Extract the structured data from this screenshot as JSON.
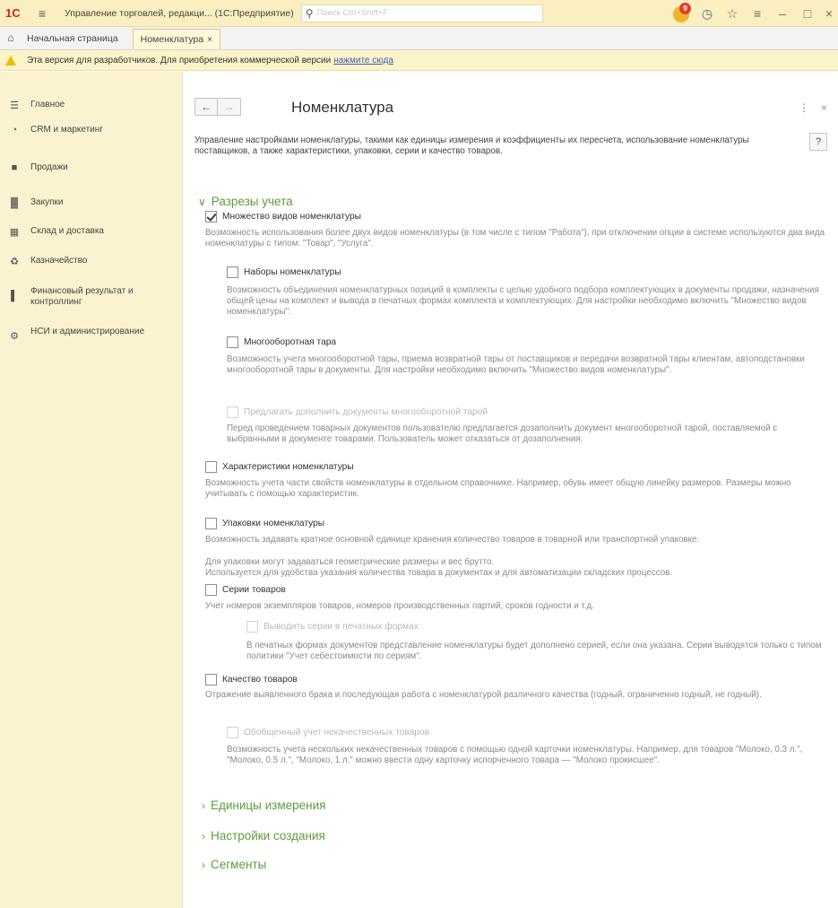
{
  "titlebar": {
    "logo": "1С",
    "title": "Управление торговлей, редакци... (1С:Предприятие)",
    "search_placeholder": "Поиск Ctrl+Shift+F",
    "notifications_count": "9"
  },
  "tabs": {
    "home_label": "Начальная страница",
    "active_label": "Номенклатура"
  },
  "warning": {
    "text": "Эта версия для разработчиков. Для приобретения коммерческой версии",
    "link": "нажмите сюда"
  },
  "sidebar": {
    "items": [
      {
        "label": "Главное",
        "icon": "menu-icon"
      },
      {
        "label": "CRM и маркетинг",
        "icon": "crm-icon"
      },
      {
        "label": "Продажи",
        "icon": "sales-icon"
      },
      {
        "label": "Закупки",
        "icon": "cart-icon"
      },
      {
        "label": "Склад и доставка",
        "icon": "warehouse-icon"
      },
      {
        "label": "Казначейство",
        "icon": "treasury-icon"
      },
      {
        "label": "Финансовый результат и контроллинг",
        "icon": "chart-icon"
      },
      {
        "label": "НСИ и администрирование",
        "icon": "gear-icon"
      }
    ]
  },
  "main": {
    "title": "Номенклатура",
    "description": "Управление настройками номенклатуры, такими как единицы измерения и коэффициенты их пересчета, использование номенклатуры поставщиков, а также характеристики, упаковки, серии и качество товаров.",
    "help": "?",
    "section_open": "Разрезы учета",
    "options": [
      {
        "label": "Множество видов номенклатуры",
        "checked": true,
        "disabled": false,
        "hint": "Возможность использования более двух видов номенклатуры (в том числе с типом \"Работа\"), при отключении опции в системе используются два вида номенклатуры с типом: \"Товар\", \"Услуга\"."
      },
      {
        "label": "Наборы номенклатуры",
        "checked": false,
        "disabled": false,
        "hint": "Возможность объединения номенклатурных позиций в комплекты с целью удобного подбора комплектующих в документы продажи, назначения общей цены на комплект и вывода в печатных формах комплекта и комплектующих. Для настройки необходимо включить \"Множество видов номенклатуры\"."
      },
      {
        "label": "Многооборотная тара",
        "checked": false,
        "disabled": false,
        "hint": "Возможность учета многооборотной тары, приема возвратной тары от поставщиков и передачи возвратной тары клиентам, автоподстановки многооборотной тары в документы. Для настройки необходимо включить \"Множество видов номенклатуры\"."
      },
      {
        "label": "Предлагать дополнить документы многооборотной тарой",
        "checked": false,
        "disabled": true,
        "hint": "Перед проведением товарных документов пользователю предлагается дозаполнить документ многооборотной тарой, поставляемой с выбранными в документе товарами. Пользователь может отказаться от дозаполнения."
      },
      {
        "label": "Характеристики номенклатуры",
        "checked": false,
        "disabled": false,
        "hint": "Возможность учета части свойств номенклатуры в отдельном справочнике. Например, обувь имеет общую линейку размеров. Размеры можно учитывать с помощью характеристик."
      },
      {
        "label": "Упаковки номенклатуры",
        "checked": false,
        "disabled": false,
        "hint": "Возможность задавать кратное основной единице хранения количество товаров в товарной или транспортной упаковке.",
        "hint2": "Для упаковки могут задаваться геометрические размеры и вес брутто.",
        "hint3": "Используется для удобства указания количества товара в документах и для автоматизации складских процессов."
      },
      {
        "label": "Серии товаров",
        "checked": false,
        "disabled": false,
        "hint": "Учет номеров экземпляров товаров, номеров производственных партий, сроков годности и т.д."
      },
      {
        "label": "Выводить серии в печатных формах",
        "checked": false,
        "disabled": true,
        "hint": "В печатных формах документов представление номенклатуры будет дополнено серией, если она указана. Серии выводятся только с типом политики \"Учет себестоимости по сериям\"."
      },
      {
        "label": "Качество товаров",
        "checked": false,
        "disabled": false,
        "hint": "Отражение выявленного брака и последующая работа с номенклатурой различного качества (годный, ограниченно годный, не годный)."
      },
      {
        "label": "Обобщенный учет некачественных товаров",
        "checked": false,
        "disabled": true,
        "hint": "Возможность учета нескольких некачественных товаров с помощью одной карточки номенклатуры. Например, для товаров \"Молоко, 0.3 л.\", \"Молоко, 0.5 л.\", \"Молоко, 1 л.\" можно ввести одну карточку испорченного товара — \"Молоко прокисшее\"."
      }
    ],
    "collapsed_sections": [
      "Единицы измерения",
      "Настройки создания",
      "Сегменты"
    ]
  },
  "colors": {
    "titlebar_bg": "#fbeec1",
    "sidebar_bg": "#fbf3cf",
    "section_green": "#5d9c3a",
    "link_blue": "#3960b6"
  }
}
